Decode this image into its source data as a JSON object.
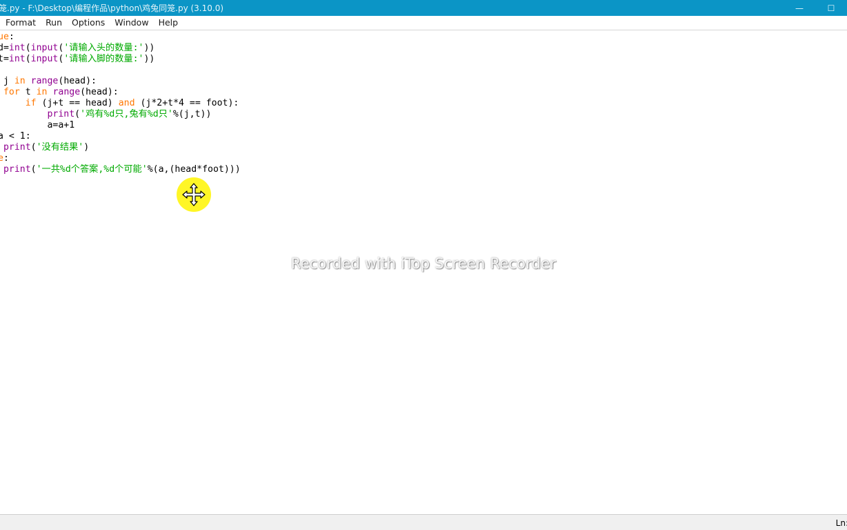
{
  "window": {
    "title": "笼.py - F:\\Desktop\\编程作品\\python\\鸡兔同笼.py (3.10.0)",
    "minimize_glyph": "—",
    "restore_glyph": "☐",
    "close_glyph": "✕"
  },
  "menu": {
    "items": [
      "Format",
      "Run",
      "Options",
      "Window",
      "Help"
    ]
  },
  "code": {
    "lines": [
      [
        {
          "t": "ue",
          "c": "kw"
        },
        {
          "t": ":",
          "c": ""
        }
      ],
      [
        {
          "t": "d=",
          "c": ""
        },
        {
          "t": "int",
          "c": "bi"
        },
        {
          "t": "(",
          "c": ""
        },
        {
          "t": "input",
          "c": "bi"
        },
        {
          "t": "(",
          "c": ""
        },
        {
          "t": "'请输入头的数量:'",
          "c": "str"
        },
        {
          "t": "))",
          "c": ""
        }
      ],
      [
        {
          "t": "t=",
          "c": ""
        },
        {
          "t": "int",
          "c": "bi"
        },
        {
          "t": "(",
          "c": ""
        },
        {
          "t": "input",
          "c": "bi"
        },
        {
          "t": "(",
          "c": ""
        },
        {
          "t": "'请输入脚的数量:'",
          "c": "str"
        },
        {
          "t": "))",
          "c": ""
        }
      ],
      [
        {
          "t": "",
          "c": ""
        }
      ],
      [
        {
          "t": " j ",
          "c": ""
        },
        {
          "t": "in",
          "c": "kw"
        },
        {
          "t": " ",
          "c": ""
        },
        {
          "t": "range",
          "c": "bi"
        },
        {
          "t": "(head):",
          "c": ""
        }
      ],
      [
        {
          "t": " ",
          "c": ""
        },
        {
          "t": "for",
          "c": "kw"
        },
        {
          "t": " t ",
          "c": ""
        },
        {
          "t": "in",
          "c": "kw"
        },
        {
          "t": " ",
          "c": ""
        },
        {
          "t": "range",
          "c": "bi"
        },
        {
          "t": "(head):",
          "c": ""
        }
      ],
      [
        {
          "t": "     ",
          "c": ""
        },
        {
          "t": "if",
          "c": "kw"
        },
        {
          "t": " (j+t == head) ",
          "c": ""
        },
        {
          "t": "and",
          "c": "kw"
        },
        {
          "t": " (j*2+t*4 == foot):",
          "c": ""
        }
      ],
      [
        {
          "t": "         ",
          "c": ""
        },
        {
          "t": "print",
          "c": "bi"
        },
        {
          "t": "(",
          "c": ""
        },
        {
          "t": "'鸡有%d只,兔有%d只'",
          "c": "str"
        },
        {
          "t": "%(j,t))",
          "c": ""
        }
      ],
      [
        {
          "t": "         a=a+1",
          "c": ""
        }
      ],
      [
        {
          "t": "a < 1:",
          "c": ""
        }
      ],
      [
        {
          "t": " ",
          "c": ""
        },
        {
          "t": "print",
          "c": "bi"
        },
        {
          "t": "(",
          "c": ""
        },
        {
          "t": "'没有结果'",
          "c": "str"
        },
        {
          "t": ")",
          "c": ""
        }
      ],
      [
        {
          "t": "e",
          "c": "kw"
        },
        {
          "t": ":",
          "c": ""
        }
      ],
      [
        {
          "t": " ",
          "c": ""
        },
        {
          "t": "print",
          "c": "bi"
        },
        {
          "t": "(",
          "c": ""
        },
        {
          "t": "'一共%d个答案,%d个可能'",
          "c": "str"
        },
        {
          "t": "%(a,(head*foot)))",
          "c": ""
        }
      ]
    ]
  },
  "status": {
    "position": "Ln:"
  },
  "watermark": {
    "text": "Recorded with iTop Screen Recorder"
  },
  "colors": {
    "titlebar": "#0b95c6",
    "keyword": "#ff7700",
    "builtin": "#900090",
    "string": "#00aa00",
    "cursor_highlight": "#fff500"
  }
}
